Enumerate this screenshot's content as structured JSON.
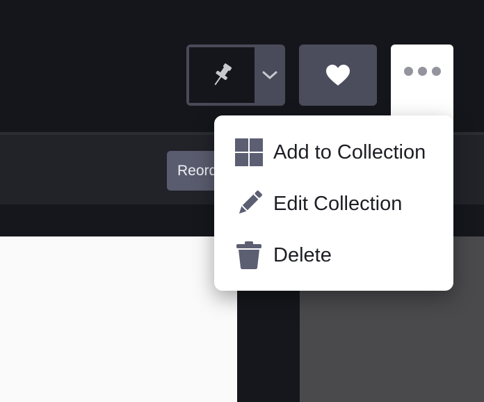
{
  "toolbar": {
    "pin_icon": "pushpin-icon",
    "dropdown_icon": "chevron-down-icon",
    "favorite_icon": "heart-icon",
    "more_icon": "more-dots-icon"
  },
  "subbar": {
    "reorder_label": "Reord"
  },
  "menu": {
    "items": [
      {
        "label": "Add to Collection",
        "icon": "grid-icon"
      },
      {
        "label": "Edit Collection",
        "icon": "pencil-icon"
      },
      {
        "label": "Delete",
        "icon": "trash-icon"
      }
    ]
  },
  "colors": {
    "background": "#15161b",
    "button": "#4b4d5c",
    "icon_gray": "#5c5e72",
    "menu_bg": "#ffffff",
    "menu_text": "#1d1e24"
  }
}
